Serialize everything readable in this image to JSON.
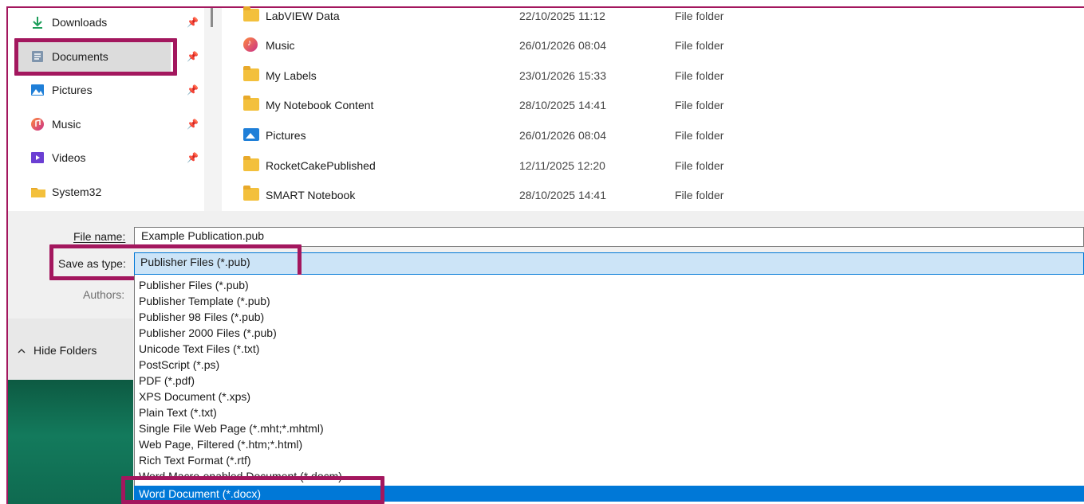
{
  "nav": {
    "items": [
      {
        "label": "Downloads",
        "icon": "download-arrow-icon",
        "pinned": true
      },
      {
        "label": "Documents",
        "icon": "documents-icon",
        "pinned": true,
        "selected": true
      },
      {
        "label": "Pictures",
        "icon": "pictures-icon",
        "pinned": true
      },
      {
        "label": "Music",
        "icon": "music-icon",
        "pinned": true
      },
      {
        "label": "Videos",
        "icon": "videos-icon",
        "pinned": true
      },
      {
        "label": "System32",
        "icon": "folder-icon",
        "pinned": false
      }
    ],
    "hide_folders_label": "Hide Folders"
  },
  "files": [
    {
      "name": "LabVIEW Data",
      "date": "22/10/2025 11:12",
      "type": "File folder",
      "icon": "folder-icon"
    },
    {
      "name": "Music",
      "date": "26/01/2026 08:04",
      "type": "File folder",
      "icon": "music-icon"
    },
    {
      "name": "My Labels",
      "date": "23/01/2026 15:33",
      "type": "File folder",
      "icon": "folder-icon"
    },
    {
      "name": "My Notebook Content",
      "date": "28/10/2025 14:41",
      "type": "File folder",
      "icon": "folder-icon"
    },
    {
      "name": "Pictures",
      "date": "26/01/2026 08:04",
      "type": "File folder",
      "icon": "pictures-icon"
    },
    {
      "name": "RocketCakePublished",
      "date": "12/11/2025 12:20",
      "type": "File folder",
      "icon": "folder-icon"
    },
    {
      "name": "SMART Notebook",
      "date": "28/10/2025 14:41",
      "type": "File folder",
      "icon": "folder-icon"
    }
  ],
  "form": {
    "file_name_label": "File name:",
    "file_name_value": "Example Publication.pub",
    "save_as_type_label": "Save as type:",
    "save_as_type_value": "Publisher Files (*.pub)",
    "authors_label": "Authors:"
  },
  "type_options": [
    "Publisher Files (*.pub)",
    "Publisher Template (*.pub)",
    "Publisher 98 Files (*.pub)",
    "Publisher 2000 Files (*.pub)",
    "Unicode Text Files (*.txt)",
    "PostScript (*.ps)",
    "PDF (*.pdf)",
    "XPS Document (*.xps)",
    "Plain Text (*.txt)",
    "Single File Web Page (*.mht;*.mhtml)",
    "Web Page, Filtered (*.htm;*.html)",
    "Rich Text Format (*.rtf)",
    "Word Macro-enabled Document (*.docm)",
    "Word Document (*.docx)"
  ],
  "selected_option": "Word Document (*.docx)",
  "colors": {
    "highlight_frame": "#a3175e",
    "selection_blue": "#0078d7",
    "type_box_bg": "#cce4f7"
  }
}
